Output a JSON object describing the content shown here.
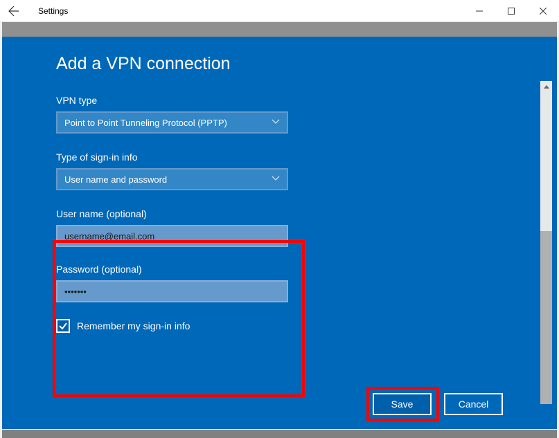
{
  "titlebar": {
    "title": "Settings"
  },
  "dialog": {
    "heading": "Add a VPN connection",
    "fields": {
      "vpn_type": {
        "label": "VPN type",
        "value": "Point to Point Tunneling Protocol (PPTP)"
      },
      "signin_type": {
        "label": "Type of sign-in info",
        "value": "User name and password"
      },
      "username": {
        "label": "User name (optional)",
        "value": "username@email.com"
      },
      "password": {
        "label": "Password (optional)",
        "value": "•••••••"
      },
      "remember": {
        "label": "Remember my sign-in info",
        "checked": true
      }
    },
    "buttons": {
      "save": "Save",
      "cancel": "Cancel"
    }
  }
}
